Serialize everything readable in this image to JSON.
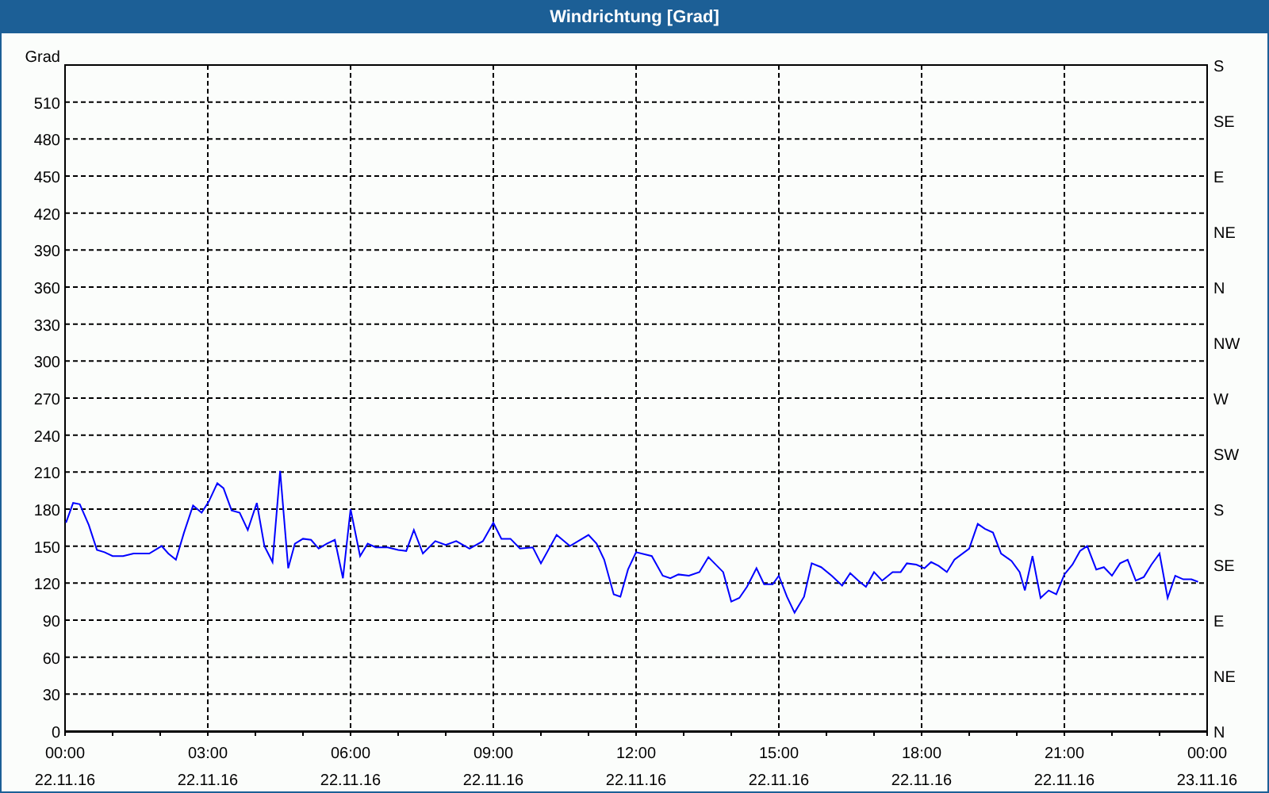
{
  "window": {
    "title": "Windrichtung [Grad]"
  },
  "chart": {
    "compass_labels": [
      "S",
      "SE",
      "E",
      "NE",
      "N",
      "NW",
      "W",
      "SW",
      "S",
      "SE",
      "E",
      "NE",
      "N"
    ],
    "date_labels": [
      "22.11.16",
      "22.11.16",
      "22.11.16",
      "22.11.16",
      "22.11.16",
      "22.11.16",
      "22.11.16",
      "22.11.16",
      "23.11.16"
    ],
    "chart_data": {
      "type": "line",
      "grid": true,
      "ylabel": "Grad",
      "xlim": [
        0,
        24
      ],
      "ylim": [
        0,
        540
      ],
      "yticks": [
        0,
        30,
        60,
        90,
        120,
        150,
        180,
        210,
        240,
        270,
        300,
        330,
        360,
        390,
        420,
        450,
        480,
        510
      ],
      "xticks": [
        {
          "value": 0,
          "label": "00:00"
        },
        {
          "value": 3,
          "label": "03:00"
        },
        {
          "value": 6,
          "label": "06:00"
        },
        {
          "value": 9,
          "label": "09:00"
        },
        {
          "value": 12,
          "label": "12:00"
        },
        {
          "value": 15,
          "label": "15:00"
        },
        {
          "value": 18,
          "label": "18:00"
        },
        {
          "value": 21,
          "label": "21:00"
        },
        {
          "value": 24,
          "label": "00:00"
        }
      ],
      "x": [
        0.02,
        0.17,
        0.31,
        0.5,
        0.67,
        0.83,
        1.0,
        1.22,
        1.44,
        1.77,
        2.03,
        2.17,
        2.33,
        2.5,
        2.69,
        2.87,
        3.02,
        3.2,
        3.33,
        3.5,
        3.67,
        3.84,
        4.03,
        4.19,
        4.36,
        4.52,
        4.69,
        4.83,
        5.0,
        5.17,
        5.33,
        5.5,
        5.67,
        5.84,
        6.0,
        6.2,
        6.36,
        6.53,
        6.78,
        7.0,
        7.17,
        7.33,
        7.52,
        7.78,
        8.0,
        8.22,
        8.5,
        8.78,
        9.0,
        9.17,
        9.36,
        9.56,
        9.83,
        10.0,
        10.33,
        10.61,
        11.0,
        11.17,
        11.33,
        11.53,
        11.67,
        11.83,
        12.0,
        12.33,
        12.56,
        12.72,
        12.89,
        13.11,
        13.33,
        13.52,
        13.83,
        14.0,
        14.17,
        14.33,
        14.53,
        14.69,
        14.87,
        15.0,
        15.17,
        15.33,
        15.53,
        15.69,
        15.89,
        16.11,
        16.33,
        16.5,
        16.67,
        16.83,
        17.0,
        17.17,
        17.39,
        17.56,
        17.69,
        17.89,
        18.06,
        18.2,
        18.36,
        18.53,
        18.69,
        19.0,
        19.18,
        19.33,
        19.5,
        19.67,
        19.89,
        20.06,
        20.17,
        20.33,
        20.5,
        20.67,
        20.83,
        21.0,
        21.17,
        21.33,
        21.48,
        21.67,
        21.83,
        22.0,
        22.17,
        22.33,
        22.5,
        22.67,
        22.83,
        23.0,
        23.17,
        23.33,
        23.5,
        23.67,
        23.81
      ],
      "series": [
        {
          "color": "#0000ff",
          "values": [
            169,
            185,
            184,
            167,
            147,
            145,
            142,
            142,
            144,
            144,
            150,
            144,
            139,
            161,
            183,
            177,
            186,
            201,
            197,
            179,
            177,
            163,
            185,
            150,
            137,
            211,
            132,
            152,
            156,
            155,
            148,
            152,
            155,
            124,
            180,
            142,
            152,
            149,
            149,
            147,
            146,
            163,
            144,
            154,
            151,
            154,
            148,
            154,
            169,
            156,
            156,
            148,
            149,
            136,
            159,
            150,
            159,
            152,
            139,
            111,
            109,
            131,
            145,
            142,
            126,
            124,
            127,
            126,
            129,
            141,
            129,
            105,
            108,
            117,
            132,
            119,
            119,
            126,
            109,
            96,
            109,
            136,
            133,
            126,
            118,
            128,
            122,
            117,
            129,
            122,
            129,
            129,
            136,
            135,
            132,
            137,
            134,
            129,
            139,
            148,
            168,
            164,
            161,
            144,
            138,
            129,
            114,
            142,
            108,
            114,
            111,
            127,
            135,
            146,
            150,
            131,
            133,
            126,
            136,
            139,
            122,
            125,
            135,
            144,
            108,
            126,
            123,
            123,
            121
          ]
        }
      ]
    }
  }
}
